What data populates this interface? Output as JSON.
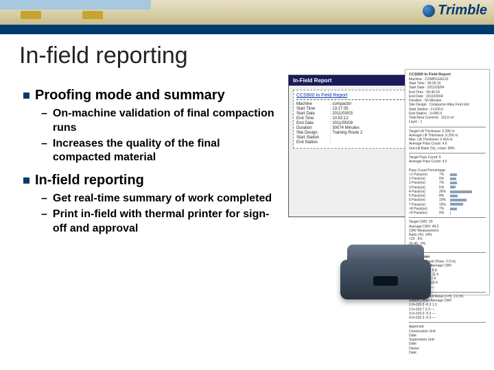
{
  "brand": "Trimble",
  "title": "In-field reporting",
  "sections": [
    {
      "heading": "Proofing mode and summary",
      "items": [
        "On-machine validation of final compaction runs",
        "Increases the quality of the final compacted material"
      ]
    },
    {
      "heading": "In-field reporting",
      "items": [
        "Get real-time summary of work completed",
        "Print in-field with thermal printer for sign-off and approval"
      ]
    }
  ],
  "report_window": {
    "titlebar": "In-Field Report",
    "subtitle": "CCS900 In Field Report",
    "rows": [
      {
        "k": "Machine",
        "v": ": compactor"
      },
      {
        "k": "Start Time",
        "v": ": 13:17:35"
      },
      {
        "k": "Start Date",
        "v": ": 2011/03/03"
      },
      {
        "k": "End Time",
        "v": ": 10:53:12"
      },
      {
        "k": "End Date",
        "v": ": 2011/05/09"
      },
      {
        "k": "Duration",
        "v": ": 30074 Minutes"
      },
      {
        "k": "Site Design",
        "v": ": Training Route 2"
      },
      {
        "k": "Start Station",
        "v": ":"
      },
      {
        "k": "End Station",
        "v": ":"
      }
    ]
  },
  "paper_report": {
    "header": "CCS900 In Field Report",
    "meta": [
      "Machine     : COMPILER122",
      "Start Time  : 05:25:10",
      "Start Date  : 2011/03/04",
      "End Time    : 06:40:19",
      "End Date    : 2011/03/04",
      "Duration    : 65 Minutes",
      "Site Design : Compactor Alley Front Ext",
      "Start Station : 2+100.0",
      "End Station   : 3+050.0",
      "Total Area Covered : 119.5 m²",
      "Layer : 1"
    ],
    "lift": [
      "Target Lift Thickness: 0.200 m",
      "Average Lift Thickness: 0.250 m",
      "Max. Lift Thickness: 0.416 m",
      "Average Pass Count: 4.6",
      "Out-Lift Ratio (%), >max: 99%"
    ],
    "pass": {
      "title": "Target Pass Count: 6",
      "sub": "Average Pass Count: 4.6",
      "label": "Pass Count Percentage:",
      "rows": [
        {
          "t": "<1 Pass(es)",
          "p": "7%",
          "w": 10
        },
        {
          "t": "1 Pass(es)",
          "p": "6%",
          "w": 9
        },
        {
          "t": "2 Pass(es)",
          "p": "7%",
          "w": 10
        },
        {
          "t": "3 Pass(es)",
          "p": "5%",
          "w": 8
        },
        {
          "t": "4 Pass(es)",
          "p": "26%",
          "w": 32
        },
        {
          "t": "5 Pass(es)",
          "p": "8%",
          "w": 11
        },
        {
          "t": "6 Pass(es)",
          "p": "19%",
          "w": 24
        },
        {
          "t": "7 Pass(es)",
          "p": "15%",
          "w": 19
        },
        {
          "t": ">8 Pass(es)",
          "p": "7%",
          "w": 10
        },
        {
          "t": ">9 Pass(es)",
          "p": "0%",
          "w": 1
        }
      ]
    },
    "cmv": {
      "title": "Target CMV: 20",
      "rows": [
        "Average CMV: 49.0",
        "CMV Measurement",
        "Ratio (%): 14%",
        "<20 : 5%",
        "20-40 : 5%",
        ">40 : 4%"
      ]
    },
    "work": {
      "title": "Work Areas",
      "sub": "Last Pass Count (Pave. 2.0 m)",
      "cols": "Station,Offset      Average CMV",
      "rows": [
        "1.0+133.3  -0.3       6.8",
        "2.0+133.3  -0.3     11.5",
        "3.0+133.3   2.7       7.4",
        "4.0+133.3   3.3     10.4",
        "5.0+133.0   0.4       —"
      ]
    },
    "work2": {
      "title": "Low Pass Count Areas (<=5, 2.0 m)",
      "cols": "Station,Offset      Average CMV",
      "rows": [
        "1.0+133.3  -0.3       1.3",
        "2.0+103.7   3.3       —",
        "3.0+103.0  -0.3       —",
        "4.0+103.3  -0.3       —"
      ]
    },
    "sign": [
      "Approved",
      "Construction Unit:",
      "Date:",
      "",
      "Supervision Unit:",
      "Date:",
      "",
      "Owner:",
      "Date:"
    ]
  }
}
